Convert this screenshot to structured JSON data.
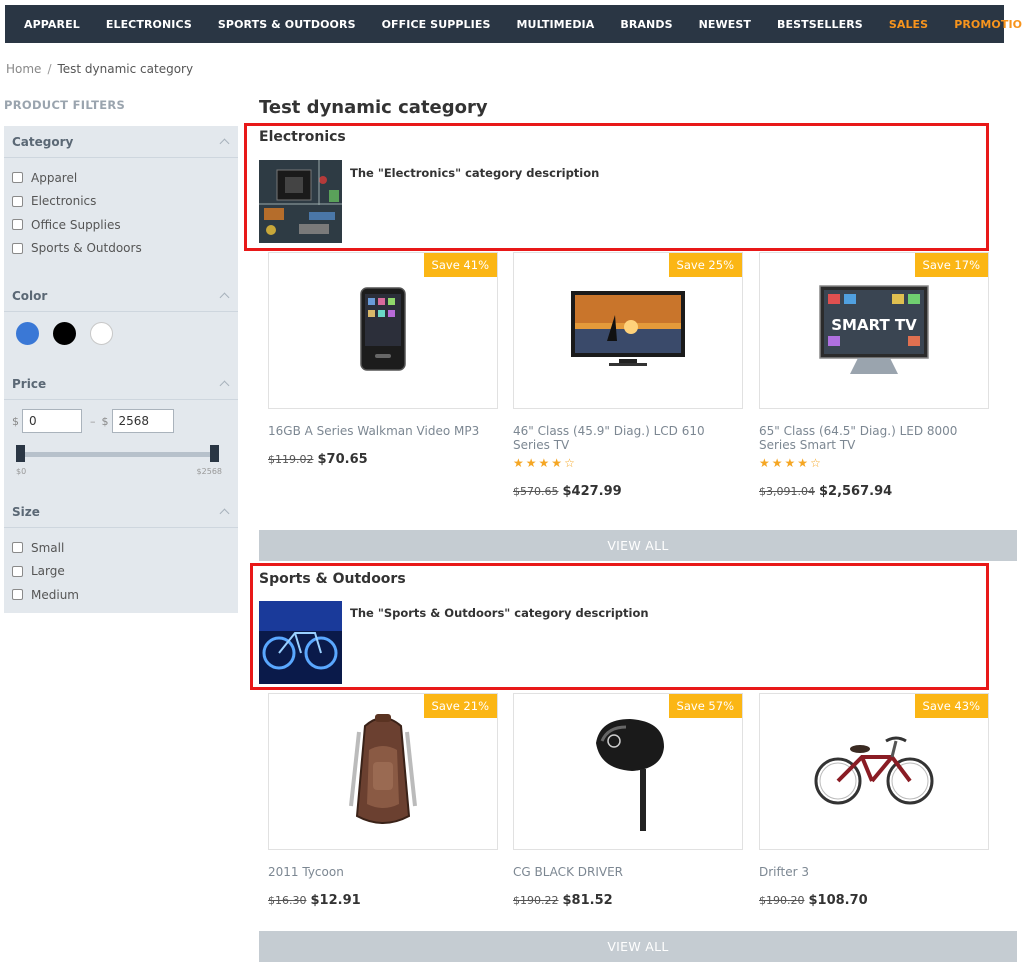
{
  "nav": {
    "items": [
      {
        "label": "APPAREL",
        "accent": false
      },
      {
        "label": "ELECTRONICS",
        "accent": false
      },
      {
        "label": "SPORTS & OUTDOORS",
        "accent": false
      },
      {
        "label": "OFFICE SUPPLIES",
        "accent": false
      },
      {
        "label": "MULTIMEDIA",
        "accent": false
      },
      {
        "label": "BRANDS",
        "accent": false
      },
      {
        "label": "NEWEST",
        "accent": false
      },
      {
        "label": "BESTSELLERS",
        "accent": false
      },
      {
        "label": "SALES",
        "accent": true
      },
      {
        "label": "PROMOTIONS",
        "accent": true
      }
    ],
    "accent_color": "#f7941d",
    "background": "#2a3644"
  },
  "breadcrumb": {
    "home": "Home",
    "separator": "/",
    "current": "Test dynamic category"
  },
  "filters": {
    "title": "PRODUCT FILTERS",
    "category": {
      "label": "Category",
      "options": [
        "Apparel",
        "Electronics",
        "Office Supplies",
        "Sports & Outdoors"
      ]
    },
    "color": {
      "label": "Color",
      "swatches": [
        "#3a78d6",
        "#000000",
        "#ffffff"
      ]
    },
    "price": {
      "label": "Price",
      "currency": "$",
      "min_value": "0",
      "max_value": "2568",
      "range_separator": "–",
      "min_label": "$0",
      "max_label": "$2568"
    },
    "size": {
      "label": "Size",
      "options": [
        "Small",
        "Large",
        "Medium"
      ]
    }
  },
  "main": {
    "title": "Test dynamic category",
    "view_all_label": "VIEW ALL",
    "highlight_color": "#e81818",
    "sections": [
      {
        "name": "Electronics",
        "description": "The \"Electronics\" category description",
        "image_icon": "circuit-board-image",
        "products": [
          {
            "name": "16GB A Series Walkman Video MP3",
            "badge": "Save 41%",
            "old_price": "$119.02",
            "price": "$70.65",
            "rating": null,
            "image_icon": "mp3-player-image"
          },
          {
            "name": "46\" Class (45.9\" Diag.) LCD 610 Series TV",
            "badge": "Save 25%",
            "old_price": "$570.65",
            "price": "$427.99",
            "rating": 4,
            "image_icon": "lcd-tv-image"
          },
          {
            "name": "65\" Class (64.5\" Diag.) LED 8000 Series Smart TV",
            "badge": "Save 17%",
            "old_price": "$3,091.04",
            "price": "$2,567.94",
            "rating": 4,
            "image_icon": "smart-tv-image",
            "image_text": "SMART TV"
          }
        ]
      },
      {
        "name": "Sports & Outdoors",
        "description": "The \"Sports & Outdoors\" category description",
        "image_icon": "bicycle-lights-image",
        "products": [
          {
            "name": "2011 Tycoon",
            "badge": "Save 21%",
            "old_price": "$16.30",
            "price": "$12.91",
            "rating": null,
            "image_icon": "backpack-image"
          },
          {
            "name": "CG BLACK DRIVER",
            "badge": "Save 57%",
            "old_price": "$190.22",
            "price": "$81.52",
            "rating": null,
            "image_icon": "golf-driver-image"
          },
          {
            "name": "Drifter 3",
            "badge": "Save 43%",
            "old_price": "$190.20",
            "price": "$108.70",
            "rating": null,
            "image_icon": "cruiser-bike-image"
          }
        ]
      }
    ]
  }
}
